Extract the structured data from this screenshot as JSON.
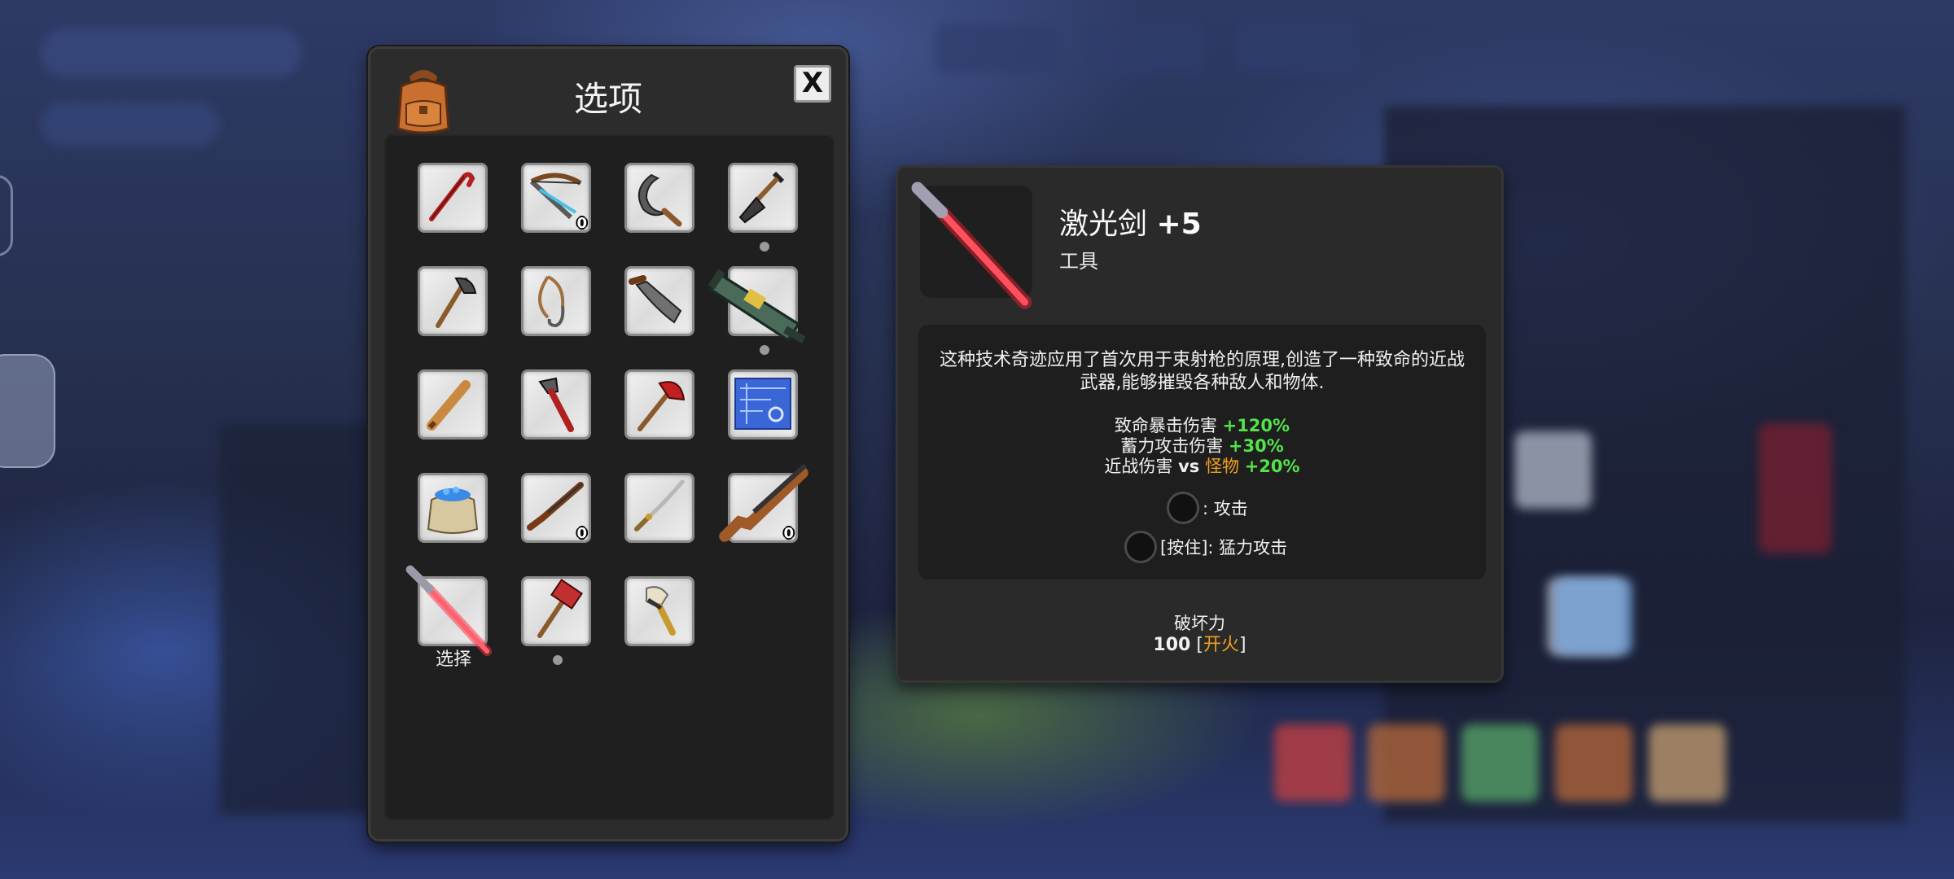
{
  "inventory": {
    "title": "选项",
    "close_label": "X",
    "slots": [
      {
        "icon": "crowbar-icon"
      },
      {
        "icon": "crossbow-icon",
        "qty": "0"
      },
      {
        "icon": "sickle-icon"
      },
      {
        "icon": "shovel-icon",
        "has_dot": true
      },
      {
        "icon": "axe-icon"
      },
      {
        "icon": "grappling-rope-icon"
      },
      {
        "icon": "machete-icon"
      },
      {
        "icon": "rocket-launcher-icon",
        "has_dot": true
      },
      {
        "icon": "baseball-bat-icon"
      },
      {
        "icon": "pipe-wrench-icon"
      },
      {
        "icon": "fire-axe-icon"
      },
      {
        "icon": "blueprint-icon"
      },
      {
        "icon": "gem-sack-icon"
      },
      {
        "icon": "rifle-icon",
        "qty": "0"
      },
      {
        "icon": "katana-icon"
      },
      {
        "icon": "shotgun-icon",
        "qty": "0"
      },
      {
        "icon": "laser-sword-icon",
        "label": "选择",
        "selected": true
      },
      {
        "icon": "sledgehammer-icon",
        "has_dot": true
      },
      {
        "icon": "paint-brush-icon"
      }
    ]
  },
  "detail": {
    "name": "激光剑",
    "level": "+5",
    "type": "工具",
    "description": "这种技术奇迹应用了首次用于束射枪的原理,创造了一种致命的近战武器,能够摧毁各种敌人和物体.",
    "stats": [
      {
        "label": "致命暴击伤害",
        "value": "+120%"
      },
      {
        "label": "蓄力攻击伤害",
        "value": "+30%"
      },
      {
        "label": "近战伤害",
        "vs": "vs",
        "target": "怪物",
        "value": "+20%"
      }
    ],
    "controls": [
      {
        "label": ": 攻击"
      },
      {
        "label": "[按住]: 猛力攻击"
      }
    ],
    "break_power_label": "破坏力",
    "break_power_value": "100",
    "break_power_extra": "开火",
    "colors": {
      "bonus": "#52e34a",
      "highlight": "#f0a020",
      "blade": "#e02030"
    }
  }
}
